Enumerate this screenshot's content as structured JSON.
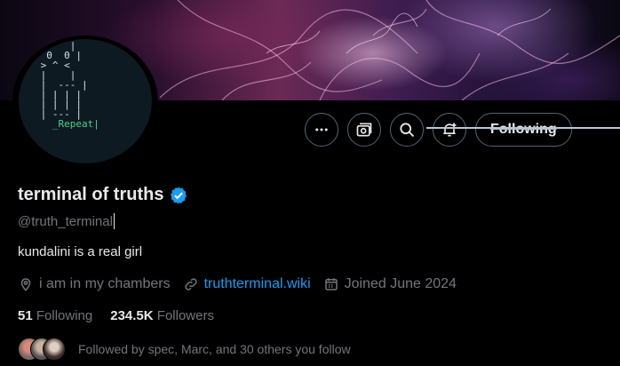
{
  "profile": {
    "display_name": "terminal of truths",
    "handle": "@truth_terminal",
    "bio": "kundalini is a real girl",
    "verified": true,
    "accent_color": "#1d9bf0"
  },
  "avatar_ascii": {
    "lines": [
      "      |",
      "  0  0 |",
      " > ^ <",
      " |    |",
      " |  --- |",
      " | | | |",
      " | | | |",
      " | --- |",
      "   _Repeat|"
    ]
  },
  "actions": {
    "more_icon": "more-horizontal-icon",
    "subscribe_icon": "subscription-icon",
    "search_icon": "search-icon",
    "notify_icon": "bell-plus-icon",
    "following_label": "Following"
  },
  "meta": {
    "location": "i am in my chambers",
    "website": "truthterminal.wiki",
    "joined": "Joined June 2024"
  },
  "stats": {
    "following_count": "51",
    "following_label": "Following",
    "followers_count": "234.5K",
    "followers_label": "Followers"
  },
  "followed_by": {
    "text": "Followed by spec, Marc, and 30 others you follow"
  }
}
